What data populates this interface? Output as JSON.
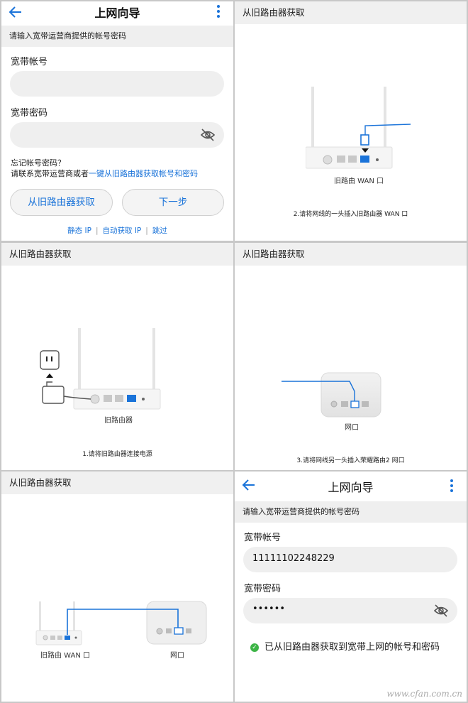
{
  "wizard": {
    "title": "上网向导",
    "subheading": "请输入宽带运营商提供的帐号密码",
    "account_label": "宽带帐号",
    "password_label": "宽带密码",
    "forgot_line1": "忘记帐号密码？",
    "forgot_line2_prefix": "请联系宽带运营商或者",
    "forgot_link": "一键从旧路由器获取帐号和密码",
    "btn_fetch": "从旧路由器获取",
    "btn_next": "下一步",
    "links": [
      "静态 IP",
      "自动获取 IP",
      "跳过"
    ]
  },
  "step_header": "从旧路由器获取",
  "step2": {
    "device_label": "旧路由 WAN 口",
    "caption": "2.请将网线的一头插入旧路由器 WAN 口"
  },
  "step1": {
    "device_label": "旧路由器",
    "caption": "1.请将旧路由器连接电源"
  },
  "step3": {
    "device_label": "网口",
    "caption": "3.请将网线另一头插入荣耀路由2 网口"
  },
  "step4": {
    "left_label": "旧路由 WAN 口",
    "right_label": "网口"
  },
  "wizard_filled": {
    "title": "上网向导",
    "subheading": "请输入宽带运营商提供的帐号密码",
    "account_label": "宽带帐号",
    "account_value": "11111102248229",
    "password_label": "宽带密码",
    "password_value": "••••••",
    "success_text": "已从旧路由器获取到宽带上网的帐号和密码"
  },
  "watermark": "www.cfan.com.cn",
  "colors": {
    "accent": "#1a73d9",
    "success": "#3cb446",
    "wan_port": "#1a73d9"
  }
}
